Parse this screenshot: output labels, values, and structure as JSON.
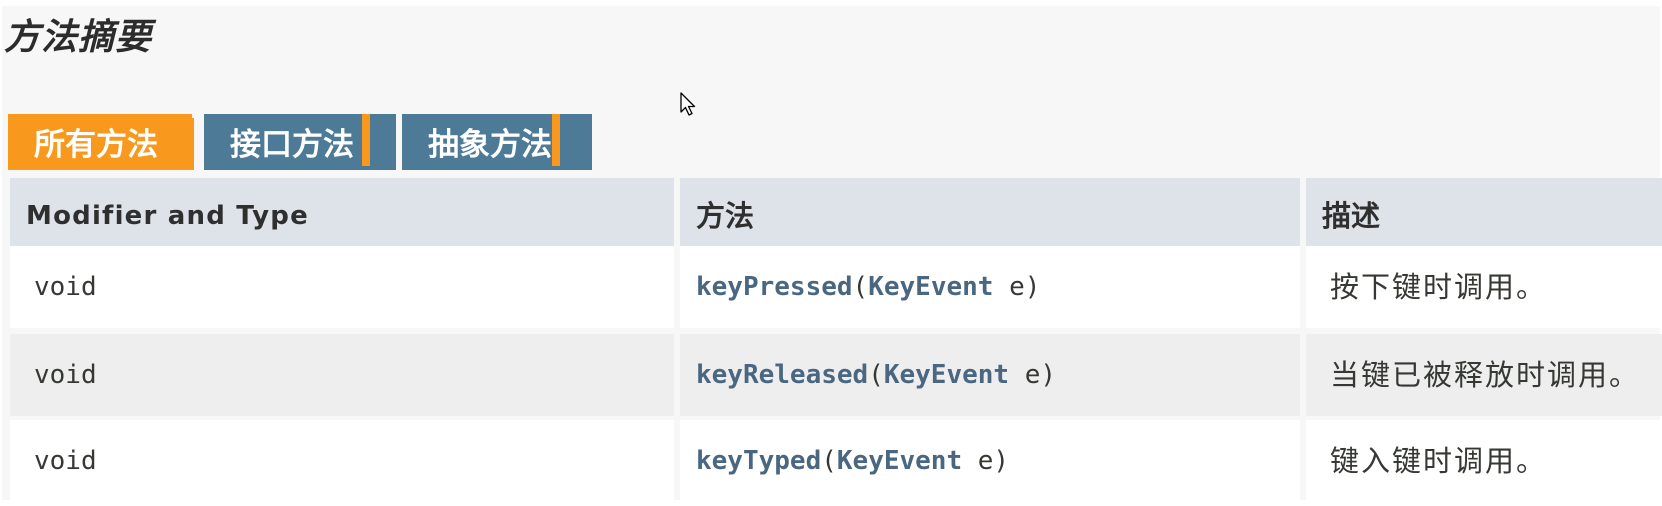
{
  "summary": {
    "heading": "方法摘要",
    "tabs": [
      {
        "label": "所有方法",
        "active": true
      },
      {
        "label": "接口方法",
        "active": false
      },
      {
        "label": "抽象方法",
        "active": false
      }
    ],
    "table": {
      "headers": {
        "modifier_type": "Modifier and Type",
        "method": "方法",
        "description": "描述"
      },
      "rows": [
        {
          "modifier_type": "void",
          "method_name": "keyPressed",
          "open_paren": "(",
          "param_type": "KeyEvent",
          "param_name": " e)",
          "description": "按下键时调用。"
        },
        {
          "modifier_type": "void",
          "method_name": "keyReleased",
          "open_paren": "(",
          "param_type": "KeyEvent",
          "param_name": " e)",
          "description": "当键已被释放时调用。"
        },
        {
          "modifier_type": "void",
          "method_name": "keyTyped",
          "open_paren": "(",
          "param_type": "KeyEvent",
          "param_name": " e)",
          "description": "键入键时调用。"
        }
      ]
    }
  },
  "colors": {
    "active_tab": "#f8981d",
    "inactive_tab": "#4d7a97",
    "header_bg": "#dee3e9",
    "link": "#4a6782"
  },
  "icons": {
    "cursor": "mouse-pointer-icon"
  }
}
